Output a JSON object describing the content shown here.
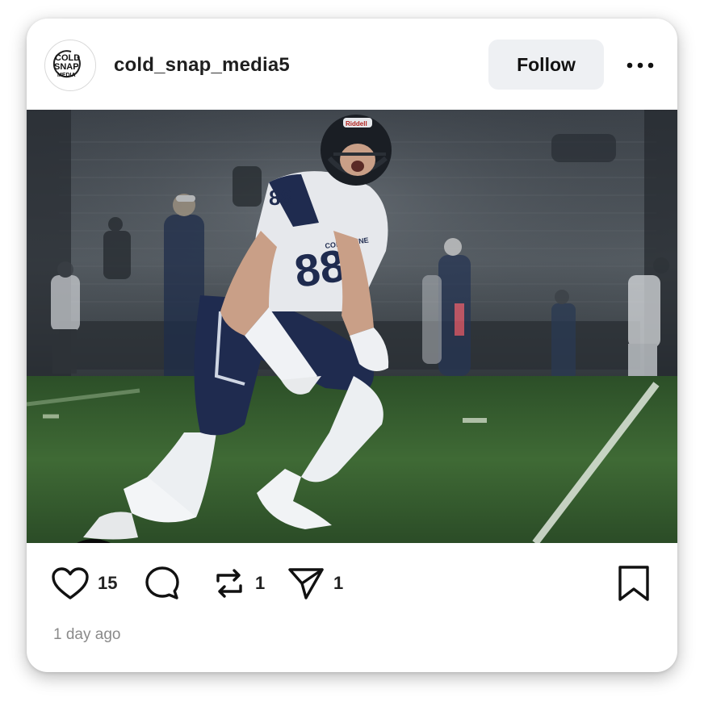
{
  "post": {
    "author": {
      "username": "cold_snap_media5",
      "avatar_text": [
        "COLD",
        "SNAP",
        "MEDIA"
      ],
      "avatar_icon": "cold-snap-logo"
    },
    "follow_label": "Follow",
    "more_icon": "ellipsis-horizontal",
    "photo": {
      "subject": "football-player",
      "jersey_number": "88",
      "jersey_text": "COLUMBINE",
      "helmet_text": "Riddell"
    },
    "badge": {
      "icon": "patriots-style-team-logo",
      "repost_icon": "repost-arrows-icon",
      "repost_color": "#8e63d8"
    },
    "actions": {
      "like_count": "15",
      "comment_count": "",
      "repost_count": "1",
      "share_count": "1"
    },
    "timestamp": "1 day ago"
  },
  "colors": {
    "follow_bg": "#eef0f3",
    "text": "#1f1f1f",
    "muted": "#8a8a8a",
    "turf": "#2f5a2b",
    "jersey_navy": "#1f2b4f"
  }
}
